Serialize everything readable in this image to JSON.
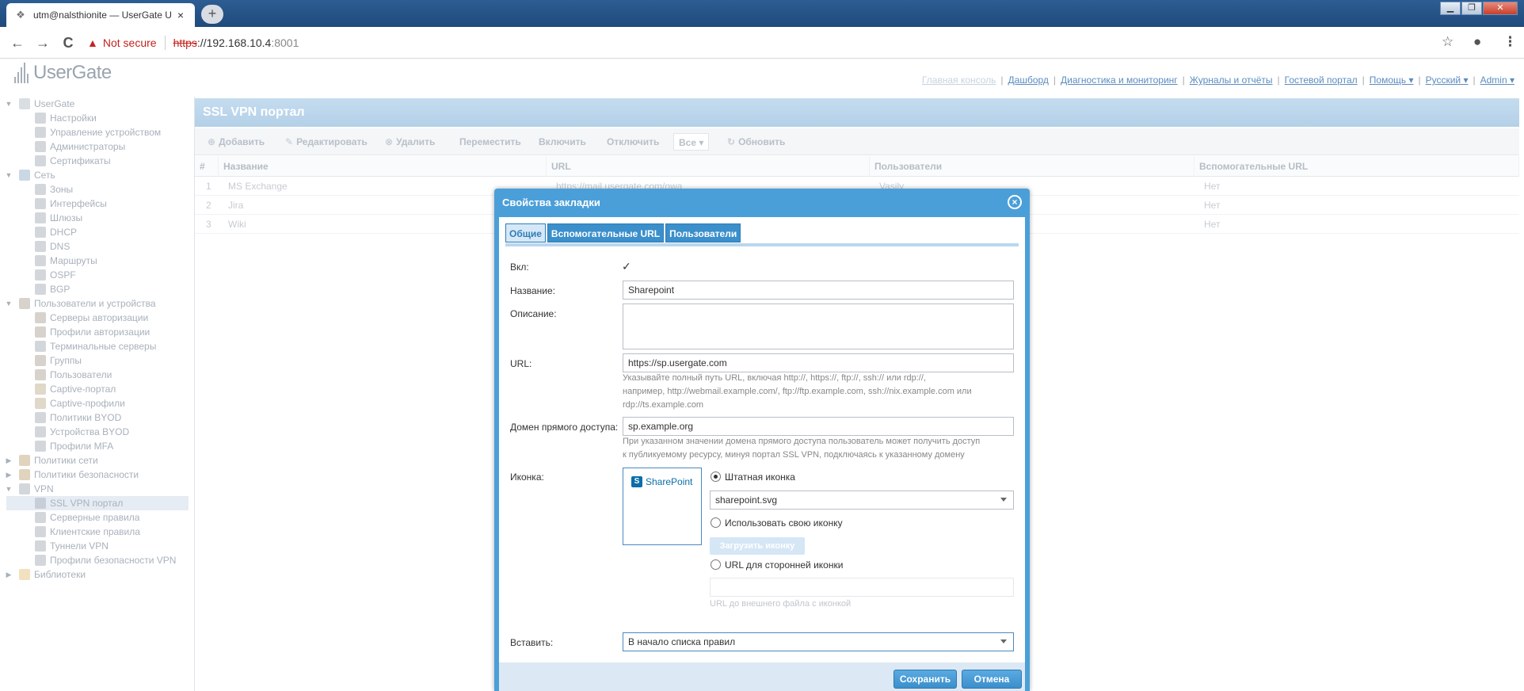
{
  "browser": {
    "tab_title": "utm@nalsthionite — UserGate U",
    "tab_close": "×",
    "new_tab": "+",
    "not_secure": "Not secure",
    "url_scheme": "https",
    "url_host": "://192.168.10.4",
    "url_port": ":8001",
    "back_icon": "←",
    "forward_icon": "→",
    "reload_icon": "C",
    "star_icon": "☆",
    "profile_icon": "●",
    "menu_icon": "⋮"
  },
  "app": {
    "logo_text": "UserGate",
    "topnav": [
      "Главная консоль",
      "Дашборд",
      "Диагностика и мониторинг",
      "Журналы и отчёты",
      "Гостевой портал",
      "Помощь ▾",
      "Русский ▾",
      "Admin ▾"
    ]
  },
  "sidebar": {
    "items": [
      {
        "label": "UserGate",
        "level": 0,
        "arrow": "▼",
        "color": "#b9c3cc"
      },
      {
        "label": "Настройки",
        "level": 1,
        "color": "#aeb7bf"
      },
      {
        "label": "Управление устройством",
        "level": 1,
        "color": "#aeb7bf"
      },
      {
        "label": "Администраторы",
        "level": 1,
        "color": "#aeb7bf"
      },
      {
        "label": "Сертификаты",
        "level": 1,
        "color": "#aeb7bf"
      },
      {
        "label": "Сеть",
        "level": 0,
        "arrow": "▼",
        "color": "#9fb8cf"
      },
      {
        "label": "Зоны",
        "level": 1,
        "color": "#aeb7bf"
      },
      {
        "label": "Интерфейсы",
        "level": 1,
        "color": "#aeb7bf"
      },
      {
        "label": "Шлюзы",
        "level": 1,
        "color": "#aeb7bf"
      },
      {
        "label": "DHCP",
        "level": 1,
        "color": "#aeb7bf"
      },
      {
        "label": "DNS",
        "level": 1,
        "color": "#aeb7bf"
      },
      {
        "label": "Маршруты",
        "level": 1,
        "color": "#aeb7bf"
      },
      {
        "label": "OSPF",
        "level": 1,
        "color": "#aeb7bf"
      },
      {
        "label": "BGP",
        "level": 1,
        "color": "#aeb7bf"
      },
      {
        "label": "Пользователи и устройства",
        "level": 0,
        "arrow": "▼",
        "color": "#b7aea2"
      },
      {
        "label": "Серверы авторизации",
        "level": 1,
        "color": "#b7aea2"
      },
      {
        "label": "Профили авторизации",
        "level": 1,
        "color": "#b7aea2"
      },
      {
        "label": "Терминальные серверы",
        "level": 1,
        "color": "#aeb7bf"
      },
      {
        "label": "Группы",
        "level": 1,
        "color": "#b7aea2"
      },
      {
        "label": "Пользователи",
        "level": 1,
        "color": "#b7aea2"
      },
      {
        "label": "Captive-портал",
        "level": 1,
        "color": "#c7b89a"
      },
      {
        "label": "Captive-профили",
        "level": 1,
        "color": "#c7b89a"
      },
      {
        "label": "Политики BYOD",
        "level": 1,
        "color": "#aeb7bf"
      },
      {
        "label": "Устройства BYOD",
        "level": 1,
        "color": "#aeb7bf"
      },
      {
        "label": "Профили MFA",
        "level": 1,
        "color": "#aeb7bf"
      },
      {
        "label": "Политики сети",
        "level": 0,
        "arrow": "▶",
        "color": "#c7b08a"
      },
      {
        "label": "Политики безопасности",
        "level": 0,
        "arrow": "▶",
        "color": "#c7b08a"
      },
      {
        "label": "VPN",
        "level": 0,
        "arrow": "▼",
        "color": "#aeb7bf"
      },
      {
        "label": "SSL VPN портал",
        "level": 1,
        "color": "#aeb7bf",
        "selected": true
      },
      {
        "label": "Серверные правила",
        "level": 1,
        "color": "#aeb7bf"
      },
      {
        "label": "Клиентские правила",
        "level": 1,
        "color": "#aeb7bf"
      },
      {
        "label": "Туннели VPN",
        "level": 1,
        "color": "#aeb7bf"
      },
      {
        "label": "Профили безопасности VPN",
        "level": 1,
        "color": "#aeb7bf"
      },
      {
        "label": "Библиотеки",
        "level": 0,
        "arrow": "▶",
        "color": "#e8c98a"
      }
    ]
  },
  "panel": {
    "title": "SSL VPN портал",
    "toolbar": {
      "add": "Добавить",
      "edit": "Редактировать",
      "delete": "Удалить",
      "move": "Переместить",
      "enable": "Включить",
      "disable": "Отключить",
      "filter": "Все",
      "refresh": "Обновить"
    },
    "columns": [
      "#",
      "Название",
      "URL",
      "Пользователи",
      "Вспомогательные URL"
    ],
    "rows": [
      {
        "num": "1",
        "name": "MS Exchange",
        "url": "https://mail.usergate.com/owa",
        "users": "Vasily",
        "aux": "Нет"
      },
      {
        "num": "2",
        "name": "Jira",
        "url": "",
        "users": "",
        "aux": "Нет"
      },
      {
        "num": "3",
        "name": "Wiki",
        "url": "",
        "users": "",
        "aux": "Нет"
      }
    ]
  },
  "dialog": {
    "title": "Свойства закладки",
    "close": "×",
    "tabs": [
      "Общие",
      "Вспомогательные URL",
      "Пользователи"
    ],
    "enabled_label": "Вкл:",
    "enabled_check": "✓",
    "name_label": "Название:",
    "name_value": "Sharepoint",
    "desc_label": "Описание:",
    "desc_value": "",
    "url_label": "URL:",
    "url_value": "https://sp.usergate.com",
    "url_hint_1": "Указывайте полный путь URL, включая http://, https://, ftp://, ssh:// или rdp://,",
    "url_hint_2": "например, http://webmail.example.com/, ftp://ftp.example.com, ssh://nix.example.com или",
    "url_hint_3": "rdp://ts.example.com",
    "domain_label": "Домен прямого доступа:",
    "domain_value": "sp.example.org",
    "domain_hint_1": "При указанном значении домена прямого доступа пользователь может получить доступ",
    "domain_hint_2": "к публикуемому ресурсу, минуя портал SSL VPN, подключаясь к указанному домену",
    "icon_label": "Иконка:",
    "sp_logo_letter": "S",
    "sp_logo_text": "SharePoint",
    "radio_builtin": "Штатная иконка",
    "builtin_select": "sharepoint.svg",
    "radio_custom": "Использовать свою иконку",
    "upload_button": "Загрузить иконку",
    "radio_external": "URL для сторонней иконки",
    "external_placeholder": "",
    "external_hint": "URL до внешнего файла с иконкой",
    "insert_label": "Вставить:",
    "insert_value": "В начало списка правил",
    "save": "Сохранить",
    "cancel": "Отмена"
  }
}
